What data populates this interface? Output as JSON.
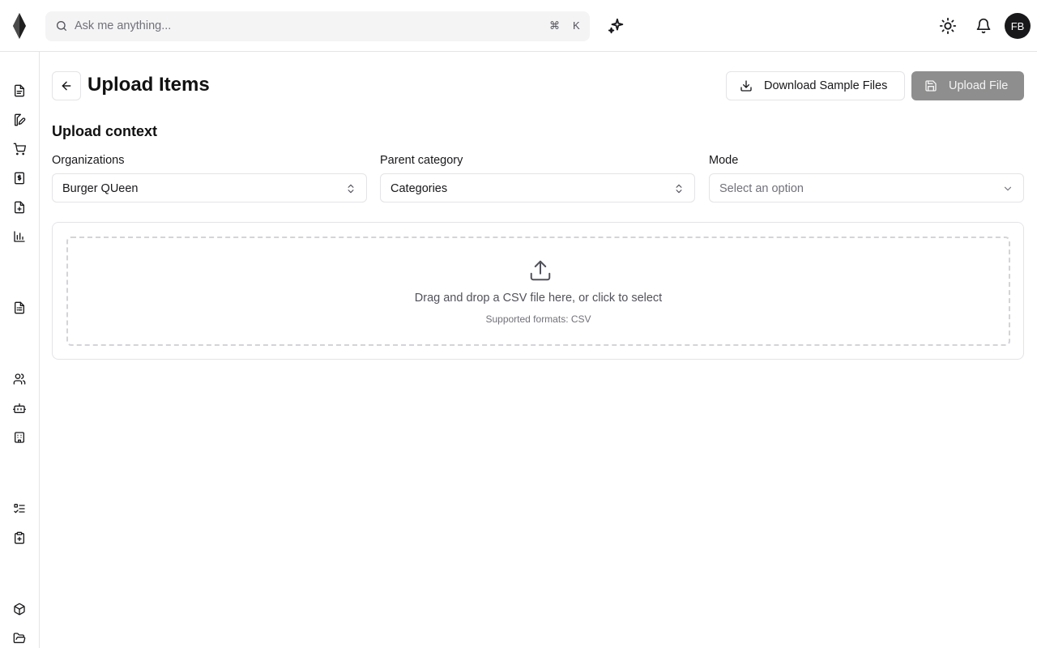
{
  "header": {
    "search_placeholder": "Ask me anything...",
    "shortcut_cmd": "⌘",
    "shortcut_key": "K",
    "avatar_initials": "FB"
  },
  "sidebar": {
    "icons": [
      "document-icon",
      "edit-document-icon",
      "cart-icon",
      "invoice-icon",
      "add-document-icon",
      "bar-chart-icon",
      "receipt-icon",
      "users-icon",
      "bot-icon",
      "building-icon",
      "checklist-icon",
      "clipboard-icon",
      "package-icon",
      "folder-icon"
    ]
  },
  "page": {
    "title": "Upload Items",
    "download_label": "Download Sample Files",
    "upload_label": "Upload File"
  },
  "context": {
    "section_title": "Upload context",
    "organizations_label": "Organizations",
    "organizations_value": "Burger QUeen",
    "parent_category_label": "Parent category",
    "parent_category_value": "Categories",
    "mode_label": "Mode",
    "mode_placeholder": "Select an option"
  },
  "dropzone": {
    "text": "Drag and drop a CSV file here, or click to select",
    "subtext": "Supported formats: CSV"
  }
}
